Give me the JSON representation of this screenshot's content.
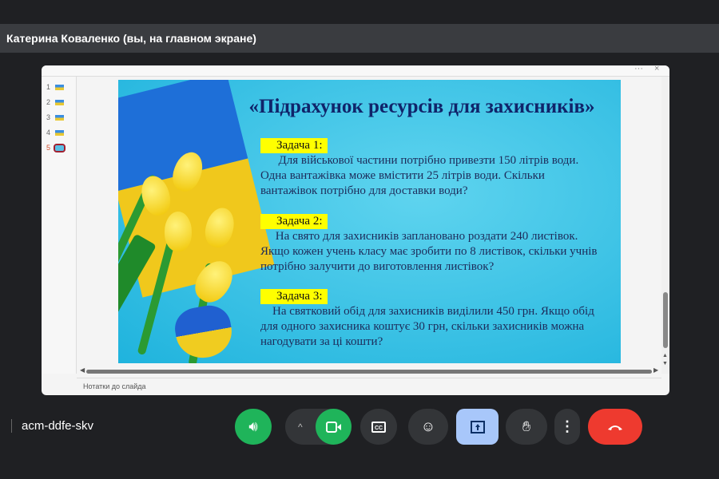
{
  "header": {
    "title": "Катерина Коваленко (вы, на главном экране)"
  },
  "window": {
    "more_icon": "···",
    "close_icon": "×"
  },
  "thumbnails": [
    {
      "num": "1"
    },
    {
      "num": "2"
    },
    {
      "num": "3"
    },
    {
      "num": "4"
    },
    {
      "num": "5",
      "active": true
    }
  ],
  "slide": {
    "title": "«Підрахунок ресурсів для захисників»",
    "tasks": [
      {
        "label": "Задача 1:",
        "lines": [
          "      Для військової частини потрібно привезти 150 літрів води.",
          "Одна вантажівка може вмістити 25 літрів води. Скільки",
          "вантажівок потрібно для доставки води?"
        ]
      },
      {
        "label": "Задача 2:",
        "lines": [
          "     На свято для захисників заплановано роздати 240 листівок.",
          "Якщо кожен учень класу має зробити по 8 листівок, скільки учнів",
          "потрібно залучити до виготовлення листівок?"
        ]
      },
      {
        "label": "Задача 3:",
        "lines": [
          "    На святковий обід для захисників виділили 450 грн. Якщо обід",
          "для одного захисника коштує 30 грн, скільки захисників можна",
          "нагодувати за ці кошти?"
        ]
      }
    ]
  },
  "notes": {
    "placeholder": "Нотатки до слайда"
  },
  "meeting": {
    "code": "acm-ddfe-skv"
  },
  "controls": {
    "colors": {
      "green": "#1fb45a",
      "red": "#ee3a2f",
      "present": "#a8c7fa",
      "dark": "#333538"
    }
  }
}
